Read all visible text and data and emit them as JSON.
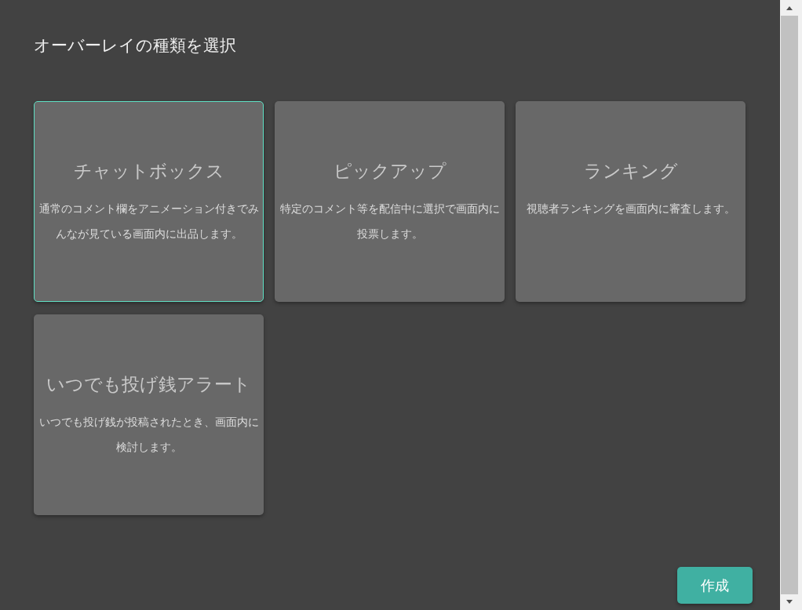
{
  "dialog": {
    "title": "オーバーレイの種類を選択"
  },
  "cards": [
    {
      "title": "チャットボックス",
      "description": "通常のコメント欄をアニメーション付きでみんなが見ている画面内に出品します。",
      "selected": true
    },
    {
      "title": "ピックアップ",
      "description": "特定のコメント等を配信中に選択で画面内に投票します。",
      "selected": false
    },
    {
      "title": "ランキング",
      "description": "視聴者ランキングを画面内に審査します。",
      "selected": false
    },
    {
      "title": "いつでも投げ銭アラート",
      "description": "いつでも投げ銭が投稿されたとき、画面内に検討します。",
      "selected": false
    }
  ],
  "buttons": [
    {
      "label": "作成"
    }
  ]
}
